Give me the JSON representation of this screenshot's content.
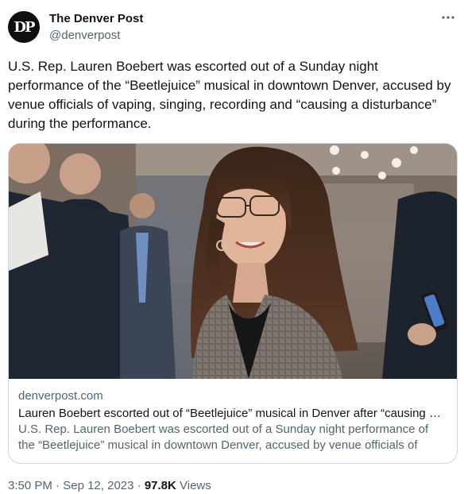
{
  "author": {
    "avatar_text": "DP",
    "display_name": "The Denver Post",
    "handle": "@denverpost"
  },
  "more_icon": "more-horizontal-icon",
  "tweet_text": "U.S. Rep. Lauren Boebert was escorted out of a Sunday night performance of the “Beetlejuice” musical in downtown Denver, accused by venue officials of vaping, singing, recording and “causing a disturbance” during the performance.",
  "card": {
    "domain": "denverpost.com",
    "title": "Lauren Boebert escorted out of “Beetlejuice” musical in Denver after “causing a disturbance”",
    "description": "U.S. Rep. Lauren Boebert was escorted out of a Sunday night performance of the “Beetlejuice” musical in downtown Denver, accused by venue officials of vaping, singing, recording and “causing a disturbance”"
  },
  "footer": {
    "time": "3:50 PM",
    "separator": "·",
    "date": "Sep 12, 2023",
    "views_count": "97.8K",
    "views_label": "Views"
  },
  "colors": {
    "text_primary": "#0f1419",
    "text_secondary": "#536471",
    "border": "#cfd9de"
  }
}
